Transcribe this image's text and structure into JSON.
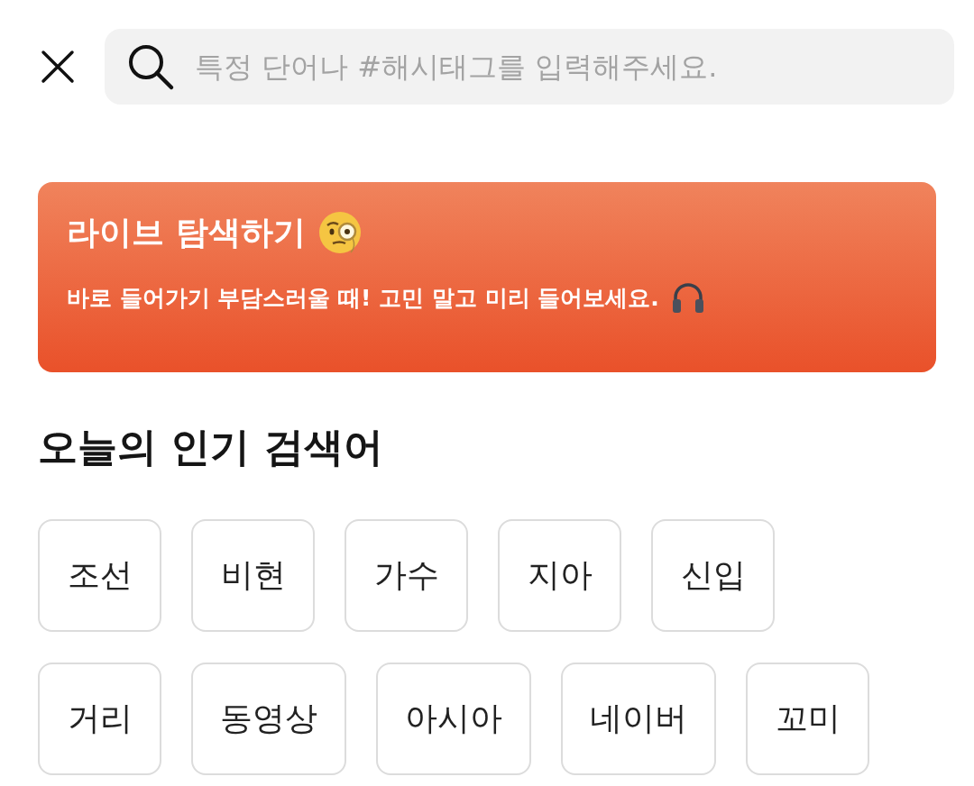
{
  "search": {
    "placeholder": "특정 단어나 #해시태그를 입력해주세요."
  },
  "banner": {
    "title": "라이브 탐색하기",
    "subtitle": "바로 들어가기 부담스러울 때! 고민 말고 미리 들어보세요."
  },
  "popular": {
    "heading": "오늘의 인기 검색어",
    "keywords": [
      "조선",
      "비현",
      "가수",
      "지아",
      "신입",
      "거리",
      "동영상",
      "아시아",
      "네이버",
      "꼬미"
    ]
  }
}
